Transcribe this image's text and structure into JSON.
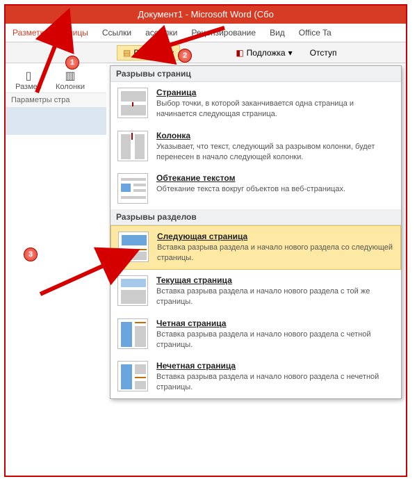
{
  "title": "Документ1 - Microsoft Word (Сбо",
  "tabs": {
    "layout": "Разметка страницы",
    "links": "Ссылки",
    "mailings": "ассылки",
    "review": "Рецензирование",
    "view": "Вид",
    "office": "Office Ta"
  },
  "toolbar": {
    "breaks": "Разрывы",
    "watermark": "Подложка",
    "indent": "Отступ"
  },
  "group": {
    "size": "Размер",
    "columns": "Колонки",
    "params": "Параметры стра"
  },
  "dropdown": {
    "header1": "Разрывы страниц",
    "header2": "Разрывы разделов",
    "items": [
      {
        "title": "Страница",
        "desc": "Выбор точки, в которой заканчивается одна страница и начинается следующая страница."
      },
      {
        "title": "Колонка",
        "desc": "Указывает, что текст, следующий за разрывом колонки, будет перенесен в начало следующей колонки."
      },
      {
        "title": "Обтекание текстом",
        "desc": "Обтекание текста вокруг объектов на веб-страницах."
      },
      {
        "title": "Следующая страница",
        "desc": "Вставка разрыва раздела и начало нового раздела со следующей страницы."
      },
      {
        "title": "Текущая страница",
        "desc": "Вставка разрыва раздела и начало нового раздела с той же страницы."
      },
      {
        "title": "Четная страница",
        "desc": "Вставка разрыва раздела и начало нового раздела с четной страницы."
      },
      {
        "title": "Нечетная страница",
        "desc": "Вставка разрыва раздела и начало нового раздела с нечетной страницы."
      }
    ]
  },
  "badges": {
    "b1": "1",
    "b2": "2",
    "b3": "3"
  }
}
